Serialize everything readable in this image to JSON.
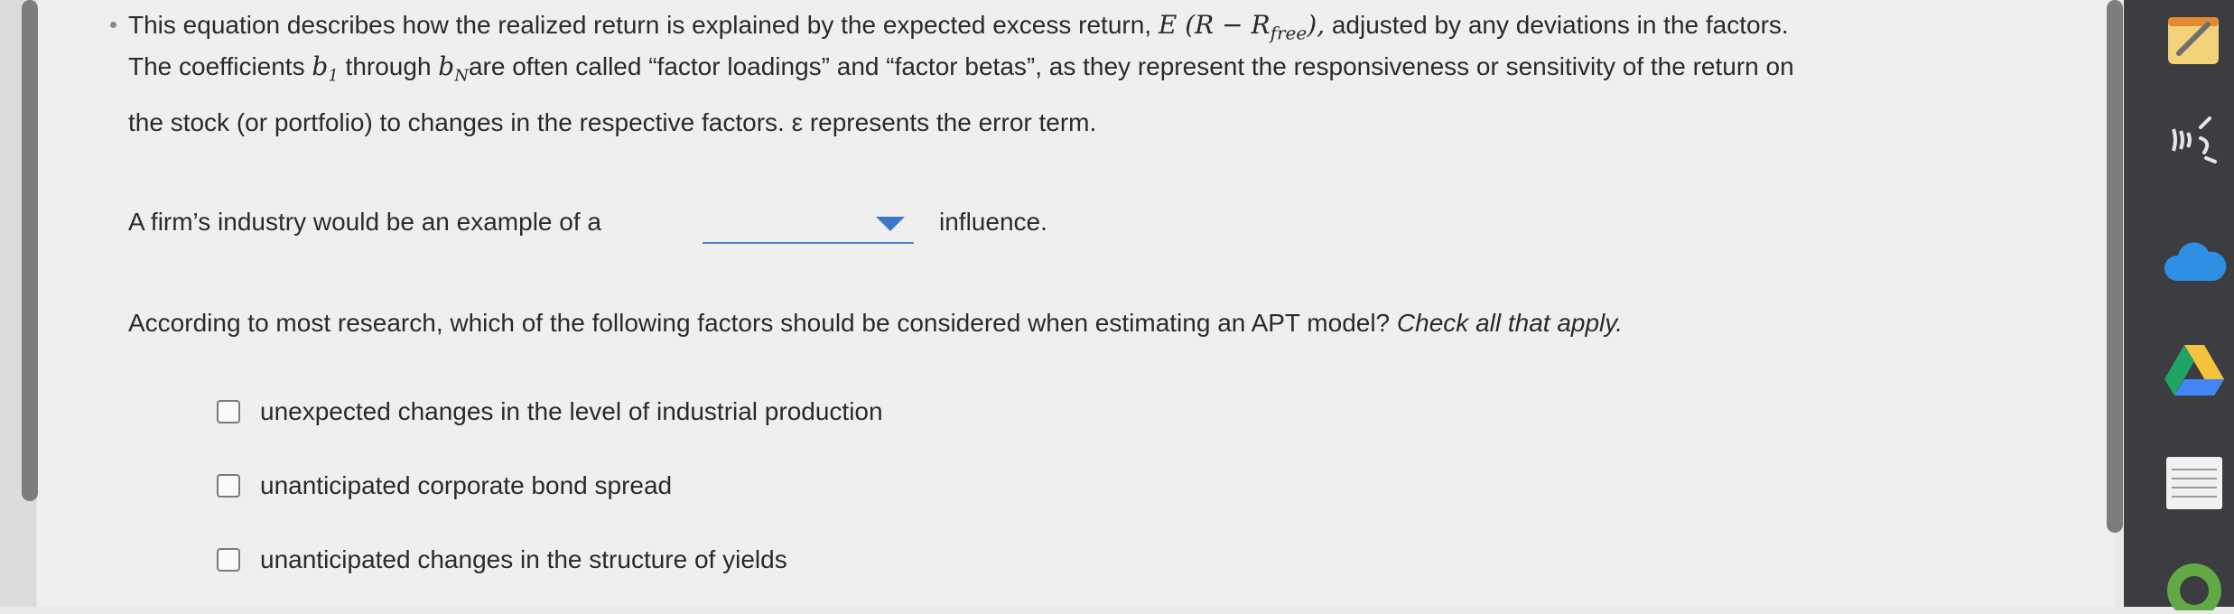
{
  "para1": {
    "line1_pre": "This equation describes how the realized return is explained by the expected excess return,",
    "math_expr": "E (R − R",
    "math_sub": "free",
    "math_close": "),",
    "line1_post": "adjusted by any deviations in the factors.",
    "line2_a": "The coefficients",
    "b1": "b",
    "b1_sub": "1",
    "line2_b": "through",
    "bN": "b",
    "bN_sub": "N",
    "line2_c": "are often called “factor loadings” and “factor betas”, as they represent the responsiveness or sensitivity of the return on",
    "line3": "the stock (or portfolio) to changes in the respective factors. ε represents the error term."
  },
  "question1": {
    "pre": "A firm’s industry would be an example of a",
    "selected": "",
    "post": "influence."
  },
  "question2": {
    "prompt": "According to most research, which of the following factors should be considered when estimating an APT model?",
    "instruction": "Check all that apply.",
    "options": [
      "unexpected changes in the level of industrial production",
      "unanticipated corporate bond spread",
      "unanticipated changes in the structure of yields"
    ]
  },
  "dock": [
    "notes-icon",
    "wifi-scan-icon",
    "cloud-icon",
    "drive-icon",
    "document-icon",
    "green-app-icon"
  ]
}
